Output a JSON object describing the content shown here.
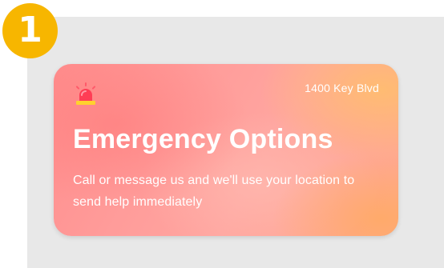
{
  "step_badge": {
    "number": "1",
    "color": "#f7b600"
  },
  "card": {
    "address": "1400 Key Blvd",
    "title": "Emergency Options",
    "description": "Call or message us and we'll use your location to send help immediately",
    "icon": "siren-alarm-icon",
    "colors": {
      "gradient_start": "#ff8d8d",
      "gradient_end": "#ffa98c",
      "text": "#ffffff"
    }
  }
}
